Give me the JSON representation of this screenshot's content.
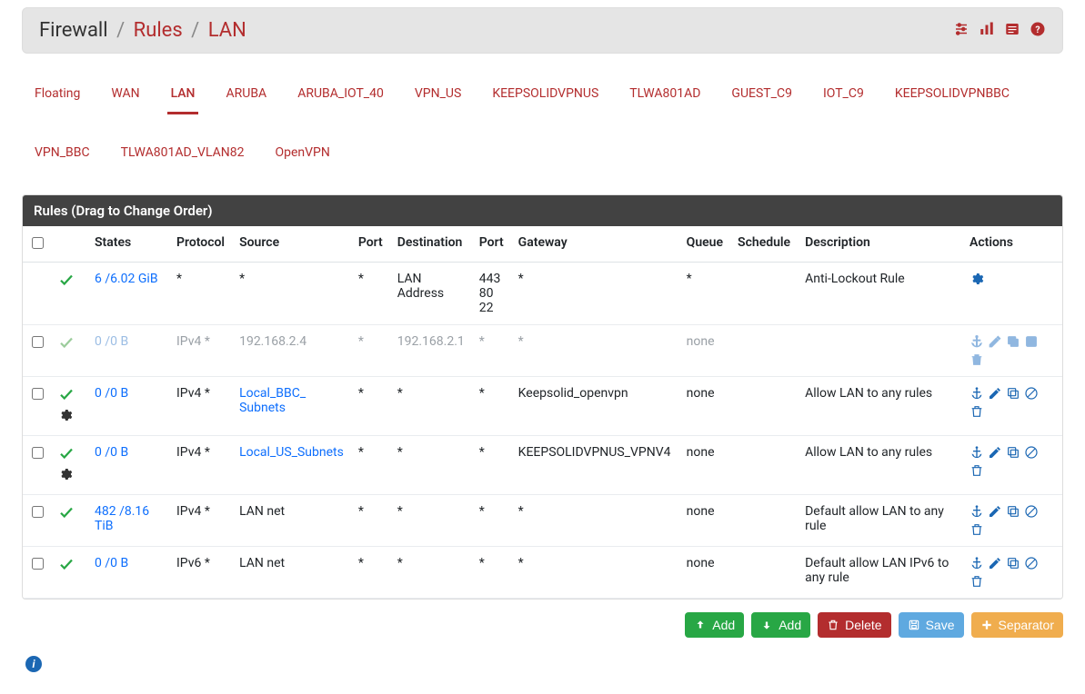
{
  "header": {
    "title": "Firewall",
    "crumbs": [
      "Rules",
      "LAN"
    ]
  },
  "tabs": {
    "items": [
      "Floating",
      "WAN",
      "LAN",
      "ARUBA",
      "ARUBA_IOT_40",
      "VPN_US",
      "KEEPSOLIDVPNUS",
      "TLWA801AD",
      "GUEST_C9",
      "IOT_C9",
      "KEEPSOLIDVPNBBC",
      "VPN_BBC",
      "TLWA801AD_VLAN82",
      "OpenVPN"
    ],
    "active": "LAN"
  },
  "panel": {
    "title": "Rules (Drag to Change Order)",
    "columns": {
      "select": "",
      "status": "",
      "states": "States",
      "protocol": "Protocol",
      "source": "Source",
      "port1": "Port",
      "destination": "Destination",
      "port2": "Port",
      "gateway": "Gateway",
      "queue": "Queue",
      "schedule": "Schedule",
      "description": "Description",
      "actions": "Actions"
    }
  },
  "rows": [
    {
      "selectable": false,
      "disabled": false,
      "extraGear": false,
      "states": "6 /6.02 GiB",
      "protocol": "*",
      "source": "*",
      "source_link": false,
      "port1": "*",
      "destination": "LAN Address",
      "port2": "443\n80\n22",
      "gateway": "*",
      "queue": "*",
      "schedule": "",
      "description": "Anti-Lockout Rule",
      "actions": "gear"
    },
    {
      "selectable": true,
      "disabled": true,
      "extraGear": false,
      "states": "0 /0 B",
      "protocol": "IPv4 *",
      "source": "192.168.2.4",
      "source_link": false,
      "port1": "*",
      "destination": "192.168.2.1",
      "port2": "*",
      "gateway": "*",
      "queue": "none",
      "schedule": "",
      "description": "",
      "actions": "std-enable"
    },
    {
      "selectable": true,
      "disabled": false,
      "extraGear": true,
      "states": "0 /0 B",
      "protocol": "IPv4 *",
      "source": "Local_BBC_\nSubnets",
      "source_link": true,
      "port1": "*",
      "destination": "*",
      "port2": "*",
      "gateway": "Keepsolid_openvpn",
      "queue": "none",
      "schedule": "",
      "description": "Allow LAN to any rules",
      "actions": "std-disable"
    },
    {
      "selectable": true,
      "disabled": false,
      "extraGear": true,
      "states": "0 /0 B",
      "protocol": "IPv4 *",
      "source": "Local_US_Subnets",
      "source_link": true,
      "port1": "*",
      "destination": "*",
      "port2": "*",
      "gateway": "KEEPSOLIDVPNUS_VPNV4",
      "queue": "none",
      "schedule": "",
      "description": "Allow LAN to any rules",
      "actions": "std-disable"
    },
    {
      "selectable": true,
      "disabled": false,
      "extraGear": false,
      "states": "482 /8.16 TiB",
      "protocol": "IPv4 *",
      "source": "LAN net",
      "source_link": false,
      "port1": "*",
      "destination": "*",
      "port2": "*",
      "gateway": "*",
      "queue": "none",
      "schedule": "",
      "description": "Default allow LAN to any rule",
      "actions": "std-disable"
    },
    {
      "selectable": true,
      "disabled": false,
      "extraGear": false,
      "states": "0 /0 B",
      "protocol": "IPv6 *",
      "source": "LAN net",
      "source_link": false,
      "port1": "*",
      "destination": "*",
      "port2": "*",
      "gateway": "*",
      "queue": "none",
      "schedule": "",
      "description": "Default allow LAN IPv6 to any rule",
      "actions": "std-disable"
    }
  ],
  "footer": {
    "addUp": "Add",
    "addDown": "Add",
    "delete": "Delete",
    "save": "Save",
    "separator": "Separator"
  }
}
